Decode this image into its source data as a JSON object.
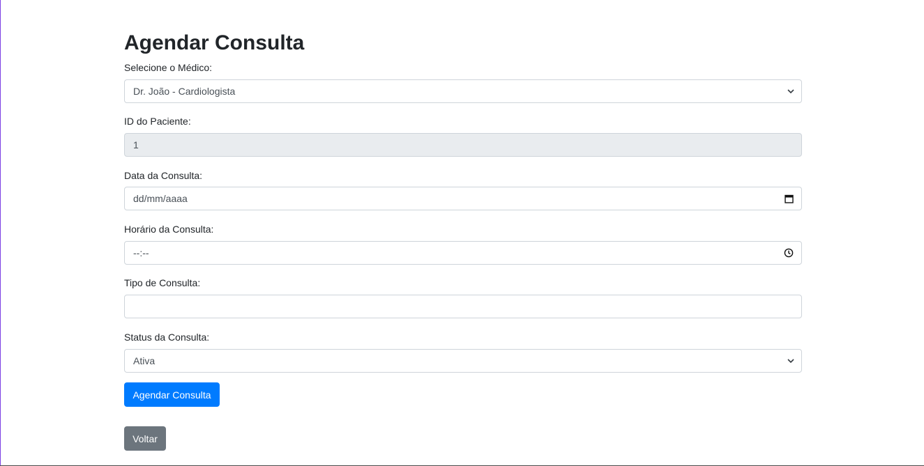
{
  "page": {
    "title": "Agendar Consulta"
  },
  "form": {
    "doctor": {
      "label": "Selecione o Médico:",
      "value": "Dr. João - Cardiologista"
    },
    "patient_id": {
      "label": "ID do Paciente:",
      "value": "1"
    },
    "date": {
      "label": "Data da Consulta:",
      "placeholder": "dd/mm/aaaa"
    },
    "time": {
      "label": "Horário da Consulta:",
      "placeholder": "--:--"
    },
    "type": {
      "label": "Tipo de Consulta:",
      "value": ""
    },
    "status": {
      "label": "Status da Consulta:",
      "value": "Ativa"
    }
  },
  "actions": {
    "submit_label": "Agendar Consulta",
    "back_label": "Voltar"
  },
  "colors": {
    "primary": "#007bff",
    "secondary": "#6c757d",
    "disabled_bg": "#e9ecef"
  },
  "icons": {
    "select_arrow": "chevron-down-icon",
    "date_picker": "calendar-icon",
    "time_picker": "clock-icon"
  }
}
